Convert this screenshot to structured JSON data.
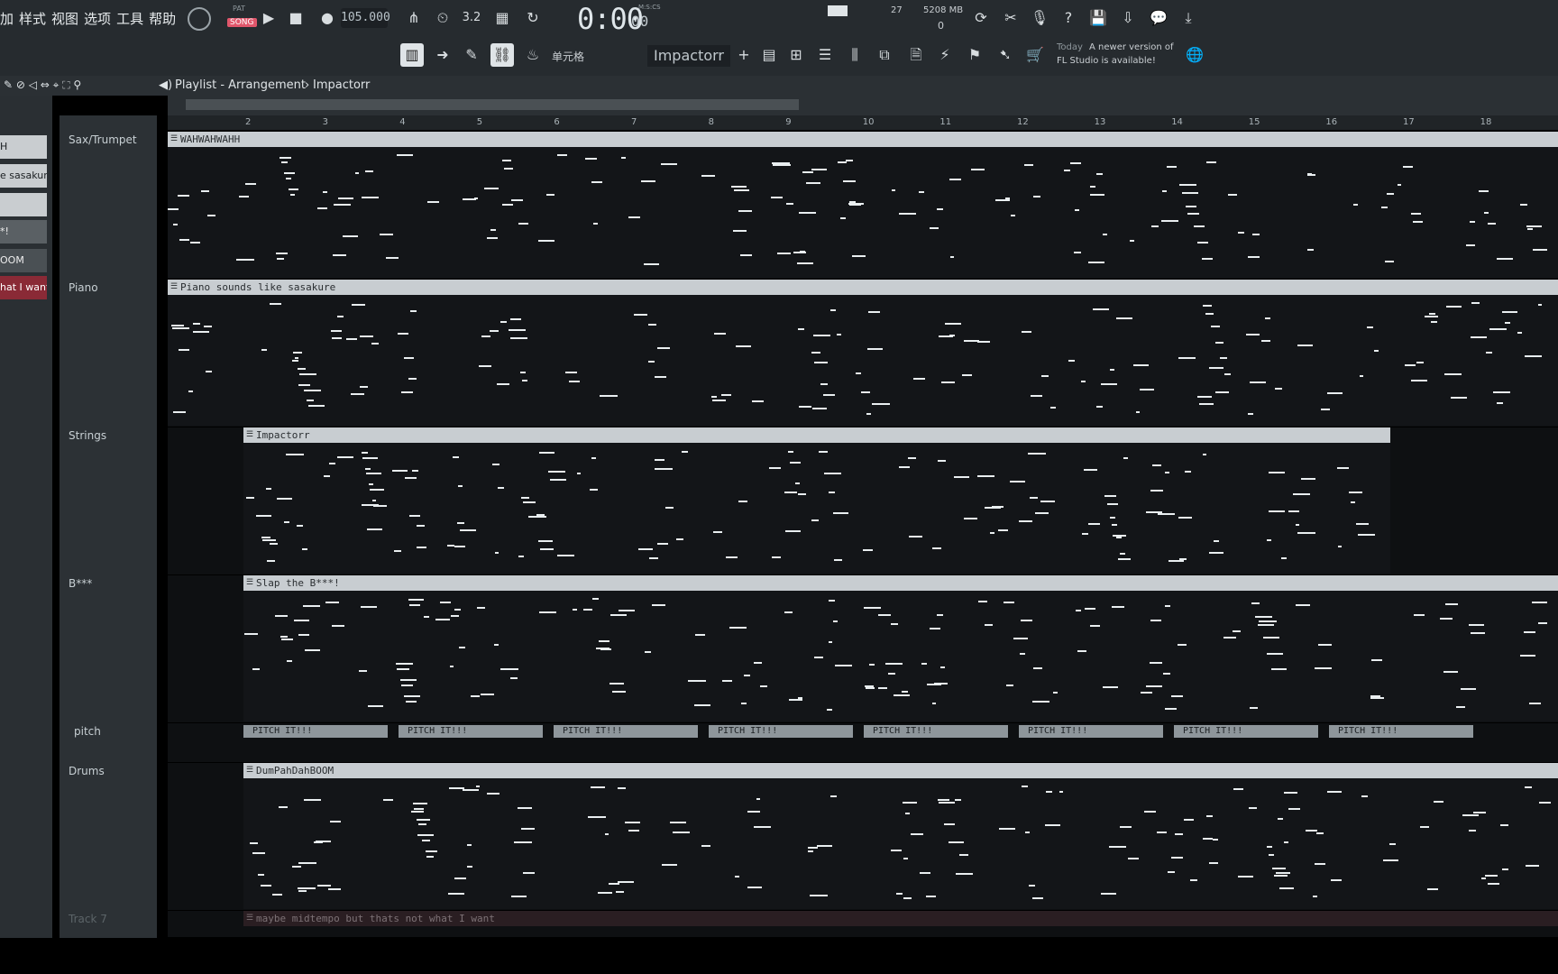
{
  "menu": [
    "加",
    "样式",
    "视图",
    "选项",
    "工具",
    "帮助"
  ],
  "transport": {
    "pat_label": "PAT",
    "song_label": "SONG",
    "tempo": "105.000",
    "time_main": "0:00",
    "time_sub": "00",
    "time_format": "M:S:CS"
  },
  "cpu": {
    "voices": "27",
    "memory": "5208 MB",
    "cpu_val": "0"
  },
  "snap": {
    "label": "单元格",
    "pattern_name": "Impactorr"
  },
  "notice": {
    "date": "Today",
    "line1": "A newer version of",
    "line2": "FL Studio is available!"
  },
  "breadcrumb": {
    "root": "Playlist - Arrangement",
    "item": "Impactorr"
  },
  "browser_items": [
    "H",
    "e sasakure",
    "",
    "*!",
    "OOM",
    "hat I want"
  ],
  "ruler": [
    "2",
    "3",
    "4",
    "5",
    "6",
    "7",
    "8",
    "9",
    "10",
    "11",
    "12",
    "13",
    "14",
    "15",
    "16",
    "17",
    "18"
  ],
  "tracks": [
    {
      "name": "Sax/Trumpet",
      "clip": "WAHWAHWAHH"
    },
    {
      "name": "Piano",
      "clip": "Piano sounds like sasakure"
    },
    {
      "name": "Strings",
      "clip": "Impactorr"
    },
    {
      "name": "B***",
      "clip": "Slap the B***!"
    },
    {
      "name": "pitch",
      "clip": "PITCH IT!!!"
    },
    {
      "name": "Drums",
      "clip": "DumPahDahBOOM"
    },
    {
      "name": "Track 7",
      "clip": "maybe midtempo but thats not what I want"
    }
  ],
  "colors": {
    "accent_pink": "#e0566b",
    "bg_dark": "#0e1012",
    "panel": "#262b2f"
  },
  "icons": [
    "play-icon",
    "stop-icon",
    "record-icon",
    "undo-icon",
    "save-icon",
    "help-icon",
    "mixer-icon",
    "piano-roll-icon",
    "channel-rack-icon",
    "browser-icon",
    "plugin-icon"
  ]
}
